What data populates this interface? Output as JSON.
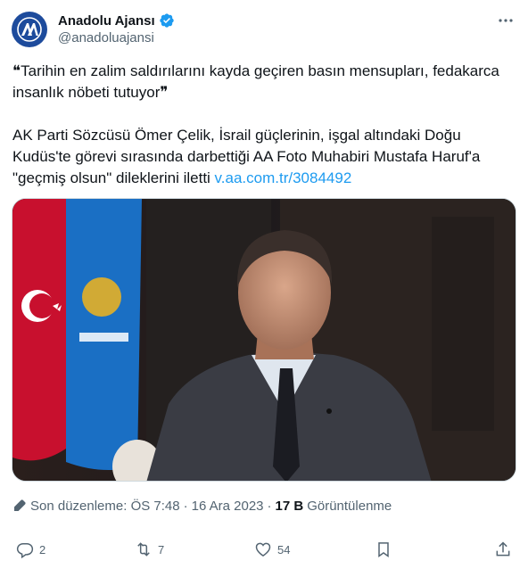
{
  "author": {
    "display_name": "Anadolu Ajansı",
    "handle": "@anadoluajansi",
    "verified": true,
    "avatar_icon": "aa-logo-icon",
    "avatar_color": "#1d4b9c"
  },
  "tweet": {
    "quote_line1": "❝Tarihin en zalim saldırılarını kayda geçiren basın mensupları, fedakarca",
    "quote_line2": "insanlık nöbeti tutuyor❞",
    "body_line1": "AK Parti Sözcüsü Ömer Çelik, İsrail güçlerinin, işgal altındaki Doğu",
    "body_line2": "Kudüs'te görevi sırasında darbettiği AA Foto Muhabiri Mustafa Haruf'a",
    "body_line3_prefix": "\"geçmiş olsun\" dileklerini iletti ",
    "link": "v.aa.com.tr/3084492"
  },
  "meta": {
    "edited_label": "Son düzenleme: ÖS 7:48",
    "date": "16 Ara 2023",
    "views_count": "17 B",
    "views_label": "Görüntülenme"
  },
  "actions": {
    "replies": "2",
    "reposts": "7",
    "likes": "54"
  },
  "colors": {
    "accent": "#1d9bf0",
    "secondary_text": "#536471",
    "primary_text": "#0f1419"
  }
}
